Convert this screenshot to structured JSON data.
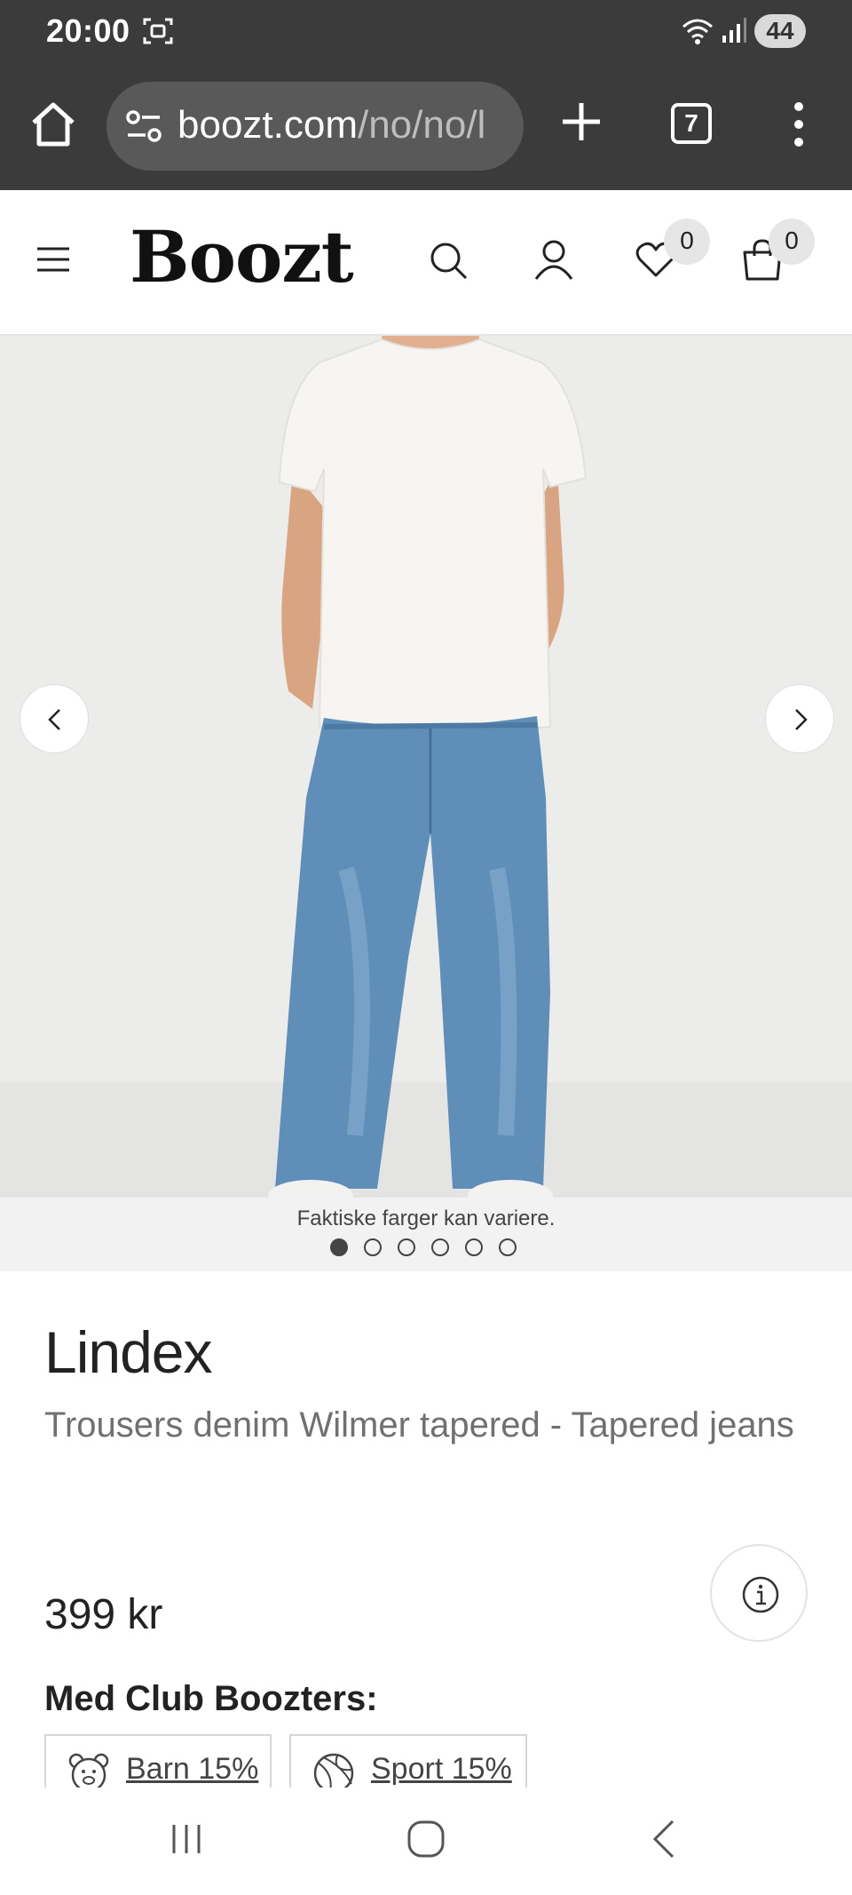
{
  "status_bar": {
    "time": "20:00",
    "battery": "44",
    "icons": [
      "screenshot-icon",
      "wifi-icon",
      "signal-icon",
      "battery-icon"
    ]
  },
  "browser": {
    "url_domain": "boozt.com",
    "url_path": "/no/no/l",
    "tab_count": "7",
    "icons": [
      "home-icon",
      "site-settings-icon",
      "new-tab-icon",
      "tabs-icon",
      "more-menu-icon"
    ]
  },
  "site_header": {
    "logo": "Boozt",
    "wishlist_count": "0",
    "cart_count": "0",
    "icons": [
      "menu-icon",
      "search-icon",
      "account-icon",
      "heart-icon",
      "bag-icon"
    ]
  },
  "gallery": {
    "caption": "Faktiske farger kan variere.",
    "slide_count": 6,
    "active_slide": 1,
    "colors": {
      "background": "#ececea",
      "tshirt": "#f6f5f1",
      "denim": "#5f8fb8"
    }
  },
  "product": {
    "brand": "Lindex",
    "name": "Trousers denim Wilmer tapered - Tapered jeans",
    "price": "399 kr",
    "club_title": "Med Club Boozters:",
    "club_offers": [
      {
        "label": "Barn 15%",
        "icon": "teddy-bear-icon"
      },
      {
        "label": "Sport 15%",
        "icon": "ball-icon"
      }
    ]
  },
  "nav_bar": {
    "icons": [
      "recents-icon",
      "home-button-icon",
      "back-icon"
    ]
  }
}
